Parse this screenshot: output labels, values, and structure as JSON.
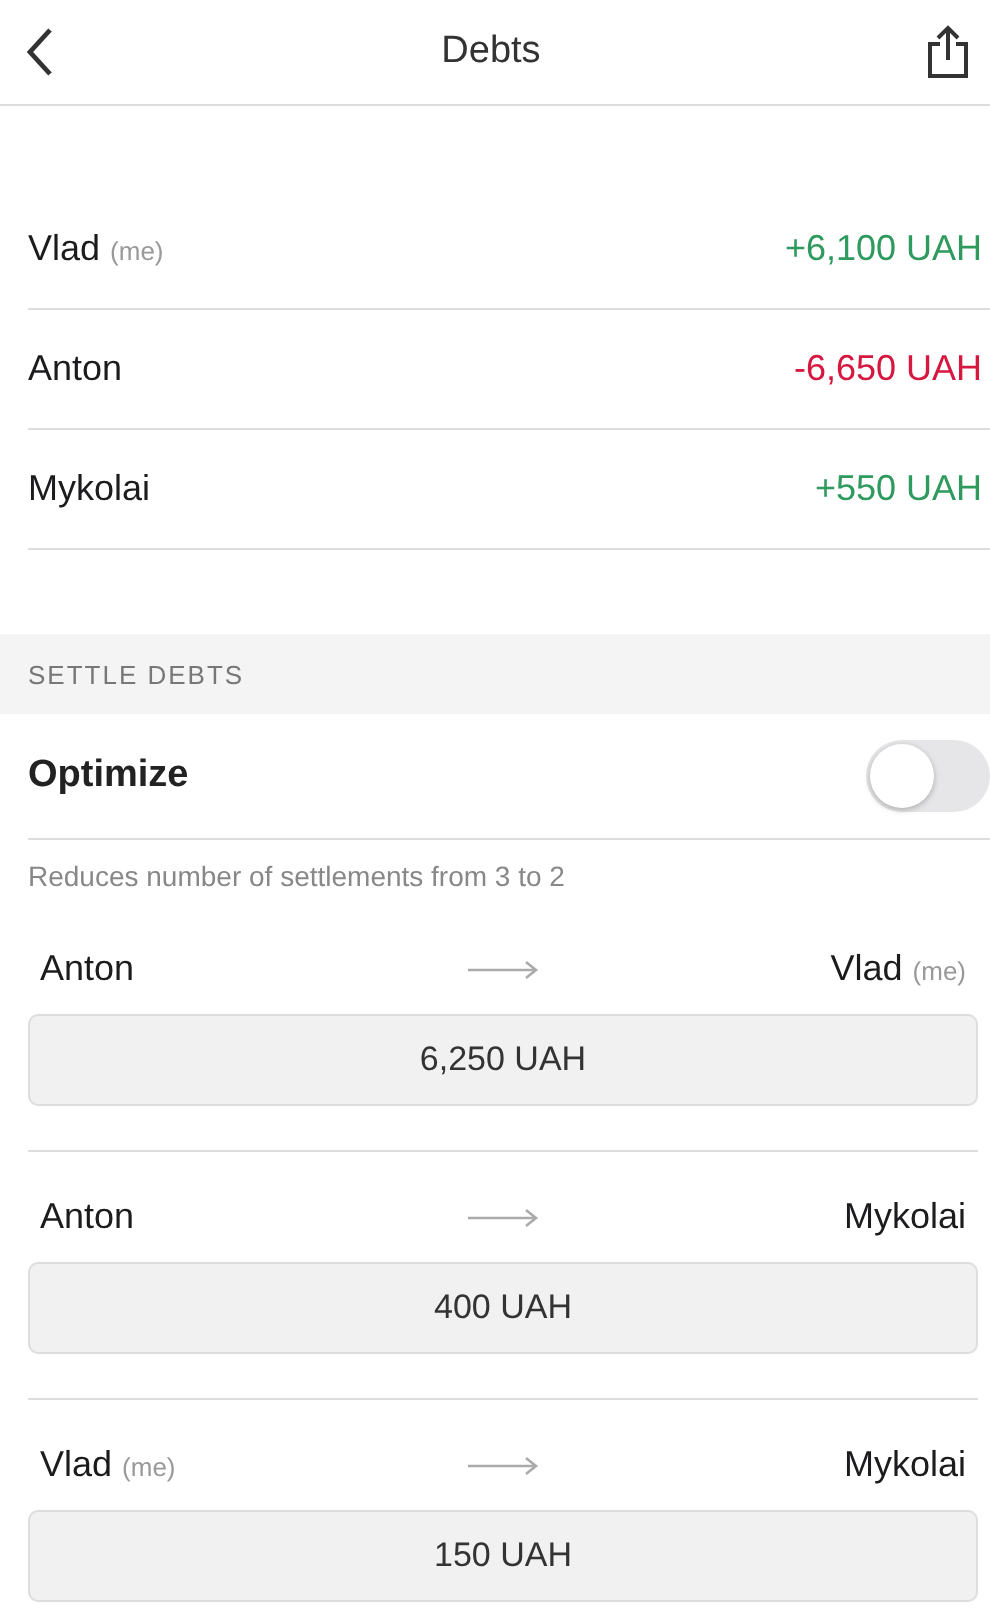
{
  "header": {
    "title": "Debts"
  },
  "balances": [
    {
      "name": "Vlad",
      "tag": "(me)",
      "amount": "+6,100 UAH",
      "color": "#2e9a5e"
    },
    {
      "name": "Anton",
      "amount": "-6,650 UAH",
      "color": "#d6173f"
    },
    {
      "name": "Mykolai",
      "amount": "+550 UAH",
      "color": "#2e9a5e"
    }
  ],
  "settle": {
    "heading": "SETTLE DEBTS",
    "optimize": {
      "label": "Optimize",
      "on": false
    },
    "description": "Reduces number of settlements from 3 to 2",
    "settlements": [
      {
        "from": {
          "name": "Anton"
        },
        "to": {
          "name": "Vlad",
          "tag": "(me)"
        },
        "amount": "6,250 UAH"
      },
      {
        "from": {
          "name": "Anton"
        },
        "to": {
          "name": "Mykolai"
        },
        "amount": "400 UAH"
      },
      {
        "from": {
          "name": "Vlad",
          "tag": "(me)"
        },
        "to": {
          "name": "Mykolai"
        },
        "amount": "150 UAH"
      }
    ]
  }
}
